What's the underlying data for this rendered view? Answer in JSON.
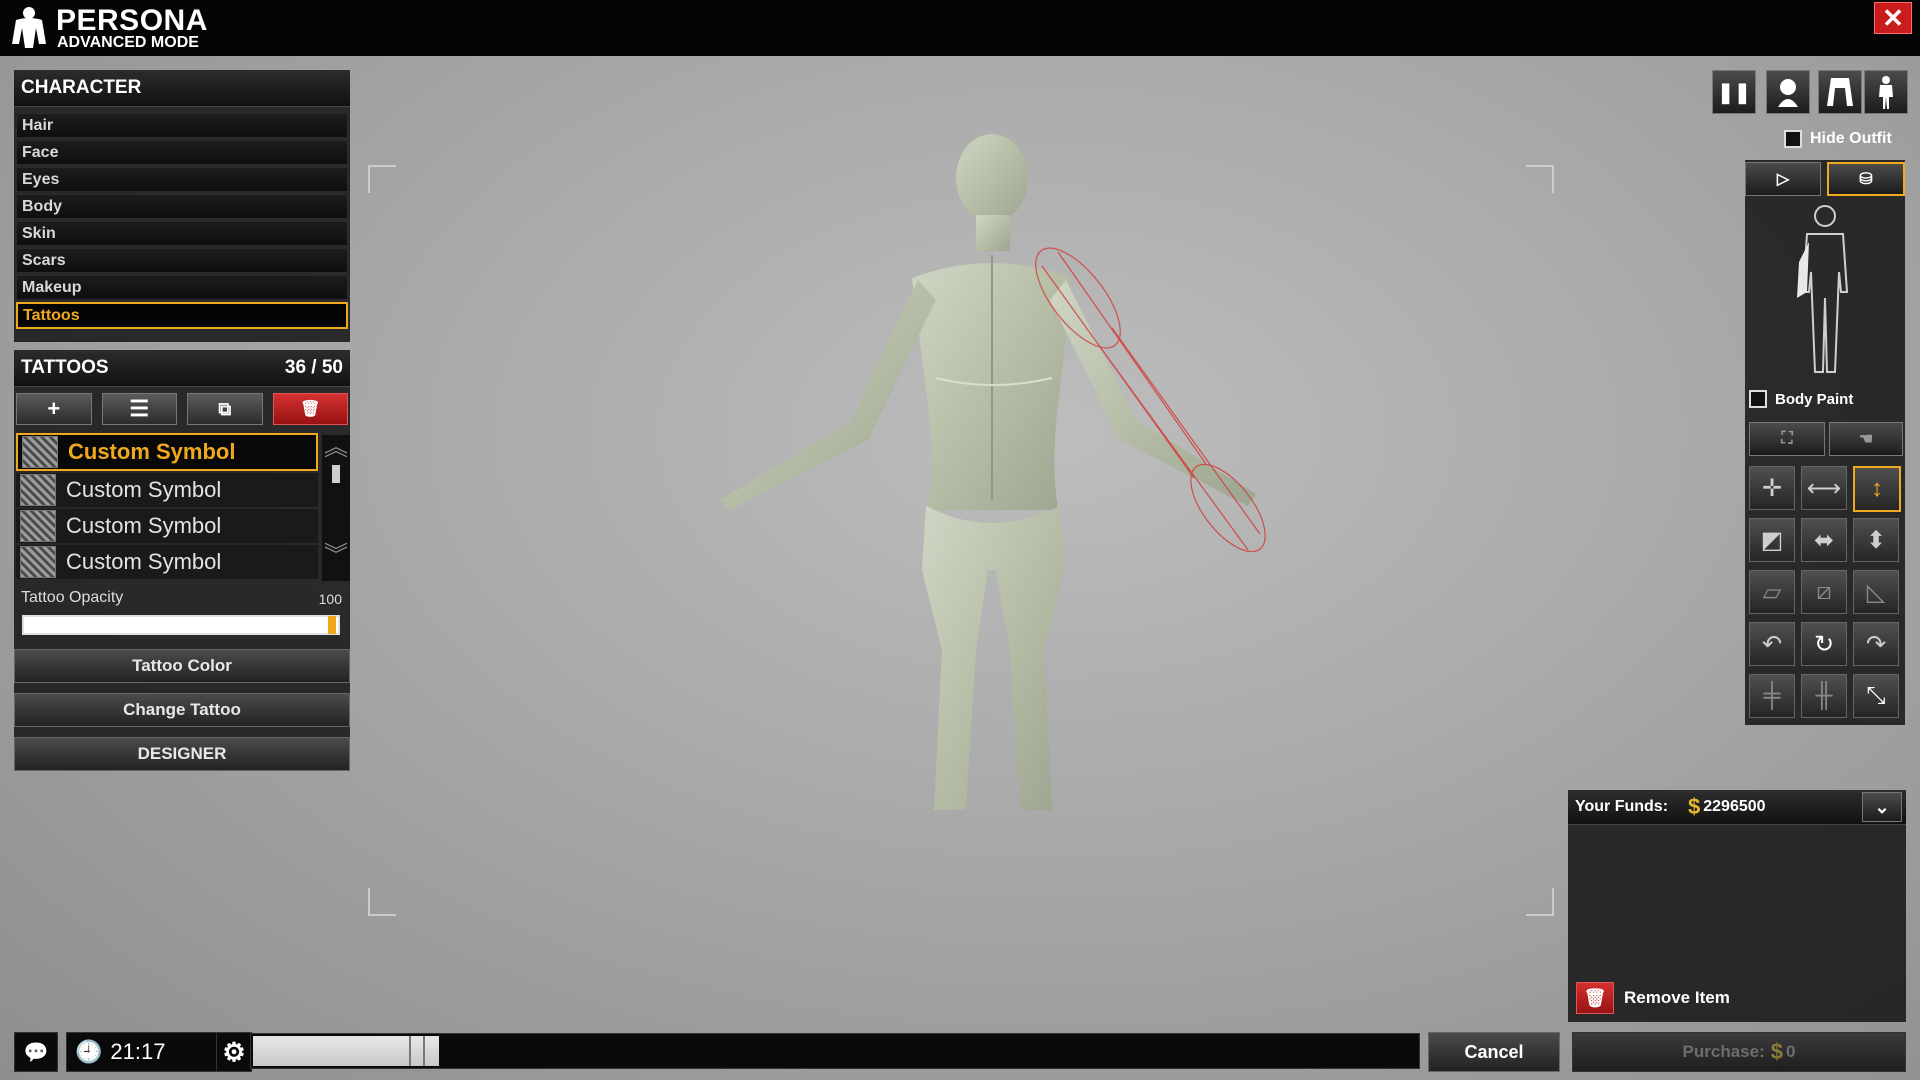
{
  "app": {
    "title": "PERSONA",
    "subtitle": "ADVANCED MODE",
    "close": "✕"
  },
  "character": {
    "header": "CHARACTER",
    "items": [
      "Hair",
      "Face",
      "Eyes",
      "Body",
      "Skin",
      "Scars",
      "Makeup",
      "Tattoos"
    ],
    "active": "Tattoos"
  },
  "tattoos": {
    "header": "TATTOOS",
    "count": "36 / 50",
    "tools": {
      "add": "+",
      "align": "☰",
      "duplicate": "⧉",
      "delete": "🗑"
    },
    "list": [
      "Custom Symbol",
      "Custom Symbol",
      "Custom Symbol",
      "Custom Symbol"
    ],
    "opacity_label": "Tattoo Opacity",
    "opacity_value": "100",
    "opacity_fraction": 1.0,
    "color_button": "Tattoo Color",
    "change_button": "Change Tattoo",
    "designer_button": "DESIGNER"
  },
  "right": {
    "hide_outfit": "Hide Outfit",
    "body_paint": "Body Paint"
  },
  "funds": {
    "label": "Your Funds:",
    "amount": "2296500",
    "remove": "Remove Item"
  },
  "bottom": {
    "time": "21:17",
    "progress_fraction": 0.16,
    "cancel": "Cancel",
    "purchase": "Purchase:",
    "purchase_amount": "0"
  },
  "colors": {
    "accent": "#f0a81f",
    "danger": "#c91d1d",
    "money": "#e8b82e"
  }
}
